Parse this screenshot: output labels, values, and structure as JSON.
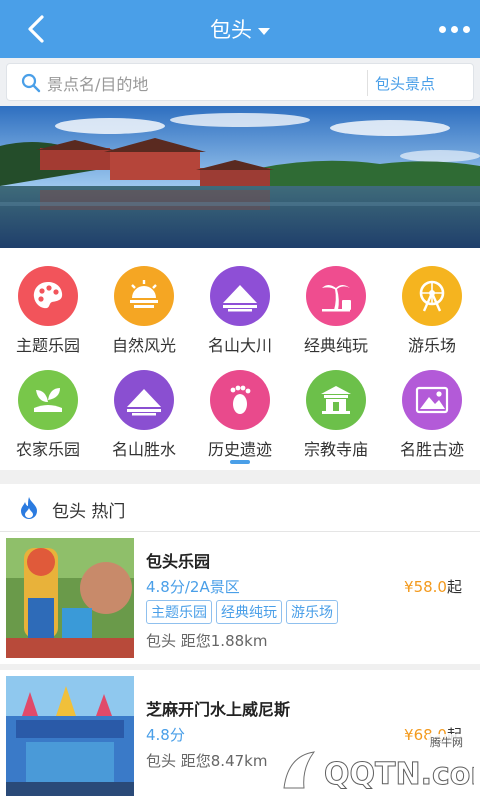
{
  "header": {
    "title": "包头"
  },
  "search": {
    "placeholder": "景点名/目的地",
    "scope": "包头景点"
  },
  "banner": {
    "dots": 3,
    "active": 1
  },
  "categories": [
    {
      "label": "主题乐园",
      "color": "#f2545b",
      "icon": "palette-icon"
    },
    {
      "label": "自然风光",
      "color": "#f5a623",
      "icon": "sunset-icon"
    },
    {
      "label": "名山大川",
      "color": "#8e4fd6",
      "icon": "mountain-icon"
    },
    {
      "label": "经典纯玩",
      "color": "#ef4d8f",
      "icon": "palm-tree-icon"
    },
    {
      "label": "游乐场",
      "color": "#f5b41f",
      "icon": "ferris-wheel-icon"
    },
    {
      "label": "农家乐园",
      "color": "#78c74a",
      "icon": "sprout-icon"
    },
    {
      "label": "名山胜水",
      "color": "#8a4fd1",
      "icon": "mountain-lake-icon"
    },
    {
      "label": "历史遗迹",
      "color": "#e94a8c",
      "icon": "footprint-icon"
    },
    {
      "label": "宗教寺庙",
      "color": "#6cc04a",
      "icon": "temple-icon"
    },
    {
      "label": "名胜古迹",
      "color": "#b35ad8",
      "icon": "landscape-icon"
    }
  ],
  "hot": {
    "title": "包头 热门"
  },
  "spots": [
    {
      "name": "包头乐园",
      "score": "4.8分/2A景区",
      "price": "¥58.0",
      "price_suffix": "起",
      "tags": [
        "主题乐园",
        "经典纯玩",
        "游乐场"
      ],
      "location": "包头 距您1.88km"
    },
    {
      "name": "芝麻开门水上威尼斯",
      "score": "4.8分",
      "price": "¥68.0",
      "price_suffix": "起",
      "tags": [],
      "location": "包头 距您8.47km"
    }
  ],
  "watermark": {
    "text": "QQTN.com",
    "small": "腾牛网"
  },
  "colors": {
    "brand": "#4a9fe8",
    "price": "#f39a1e"
  }
}
